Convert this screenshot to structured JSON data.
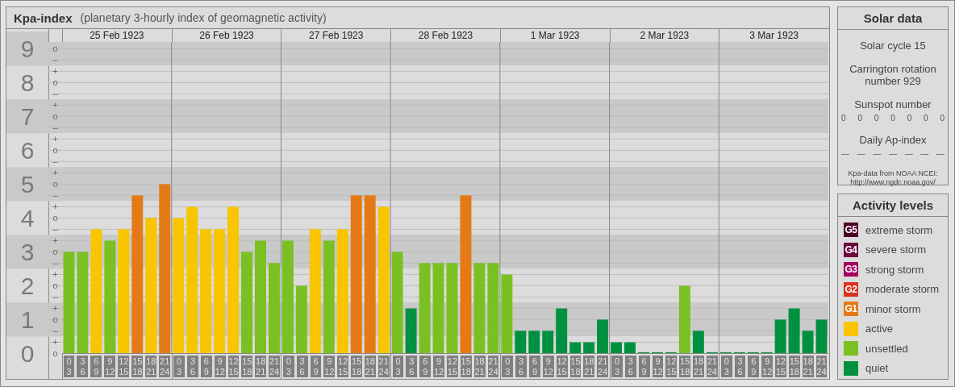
{
  "header": {
    "title": "Kpa-index",
    "subtitle": "(planetary 3-hourly index of geomagnetic activity)"
  },
  "chart": {
    "days": [
      "25 Feb 1923",
      "26 Feb 1923",
      "27 Feb 1923",
      "28 Feb 1923",
      "1 Mar 1923",
      "2 Mar 1923",
      "3 Mar 1923"
    ],
    "minor_tick_labels": [
      "o",
      "–",
      "+",
      "o",
      "–",
      "+",
      "o",
      "–",
      "+",
      "o",
      "–",
      "+",
      "o",
      "–",
      "+",
      "o",
      "–",
      "+",
      "o",
      "–",
      "+",
      "o",
      "–",
      "+",
      "o",
      "–",
      "+",
      "o"
    ],
    "chart_data": {
      "type": "bar",
      "categories": [
        "0\n3",
        "3\n6",
        "6\n9",
        "9\n12",
        "12\n15",
        "15\n18",
        "18\n21",
        "21\n24",
        "0\n3",
        "3\n6",
        "6\n9",
        "9\n12",
        "12\n15",
        "15\n18",
        "18\n21",
        "21\n24",
        "0\n3",
        "3\n6",
        "6\n9",
        "9\n12",
        "12\n15",
        "15\n18",
        "18\n21",
        "21\n24",
        "0\n3",
        "3\n6",
        "6\n9",
        "9\n12",
        "12\n15",
        "15\n18",
        "18\n21",
        "21\n24",
        "0\n3",
        "3\n6",
        "6\n9",
        "9\n12",
        "12\n15",
        "15\n18",
        "18\n21",
        "21\n24",
        "0\n3",
        "3\n6",
        "6\n9",
        "9\n12",
        "12\n15",
        "15\n18",
        "18\n21",
        "21\n24",
        "0\n3",
        "3\n6",
        "6\n9",
        "9\n12",
        "12\n15",
        "15\n18",
        "18\n21",
        "21\n24"
      ],
      "grid": true,
      "series": [
        {
          "values": [
            3,
            3,
            3.67,
            3.33,
            3.67,
            4.67,
            4,
            5,
            4,
            4.33,
            3.67,
            3.67,
            4.33,
            3,
            3.33,
            2.67,
            3.33,
            2,
            3.67,
            3.33,
            3.67,
            4.67,
            4.67,
            4.33,
            3,
            1.33,
            2.67,
            2.67,
            2.67,
            4.67,
            2.67,
            2.67,
            2.33,
            0.67,
            0.67,
            0.67,
            1.33,
            0.33,
            0.33,
            1,
            0.33,
            0.33,
            0,
            0,
            0,
            2,
            0.67,
            0,
            0,
            0,
            0,
            0,
            1,
            1.33,
            0.67,
            1
          ]
        }
      ],
      "ylim": [
        0,
        9.2
      ],
      "yticks": [
        {
          "value": 0,
          "label": "0"
        },
        {
          "value": 1,
          "label": "1"
        },
        {
          "value": 2,
          "label": "2"
        },
        {
          "value": 3,
          "label": "3"
        },
        {
          "value": 4,
          "label": "4"
        },
        {
          "value": 5,
          "label": "5"
        },
        {
          "value": 6,
          "label": "6"
        },
        {
          "value": 7,
          "label": "7"
        },
        {
          "value": 8,
          "label": "8"
        },
        {
          "value": 9,
          "label": "9"
        }
      ]
    }
  },
  "solar_data": {
    "title": "Solar data",
    "solar_cycle": "Solar cycle 15",
    "carrington_rotation": "Carrington rotation number 929",
    "sunspot_label": "Sunspot number",
    "sunspot_values": [
      "0",
      "0",
      "0",
      "0",
      "0",
      "0",
      "0"
    ],
    "ap_label": "Daily Ap-index",
    "ap_values": [
      "—",
      "—",
      "—",
      "—",
      "—",
      "—",
      "—"
    ],
    "source": "Kpa-data from NOAA NCEI:",
    "source_url": "http://www.ngdc.noaa.gov/"
  },
  "legend": {
    "title": "Activity levels",
    "items": [
      {
        "badge": "G5",
        "label": "extreme storm",
        "color": "#4b0025"
      },
      {
        "badge": "G4",
        "label": "severe storm",
        "color": "#6b0a3e"
      },
      {
        "badge": "G3",
        "label": "strong storm",
        "color": "#a3065f"
      },
      {
        "badge": "G2",
        "label": "moderate storm",
        "color": "#d9321e"
      },
      {
        "badge": "G1",
        "label": "minor storm",
        "color": "#e47a16"
      },
      {
        "label": "active",
        "color": "#f9c400"
      },
      {
        "label": "unsettled",
        "color": "#7ac023"
      },
      {
        "label": "quiet",
        "color": "#009140"
      }
    ]
  }
}
